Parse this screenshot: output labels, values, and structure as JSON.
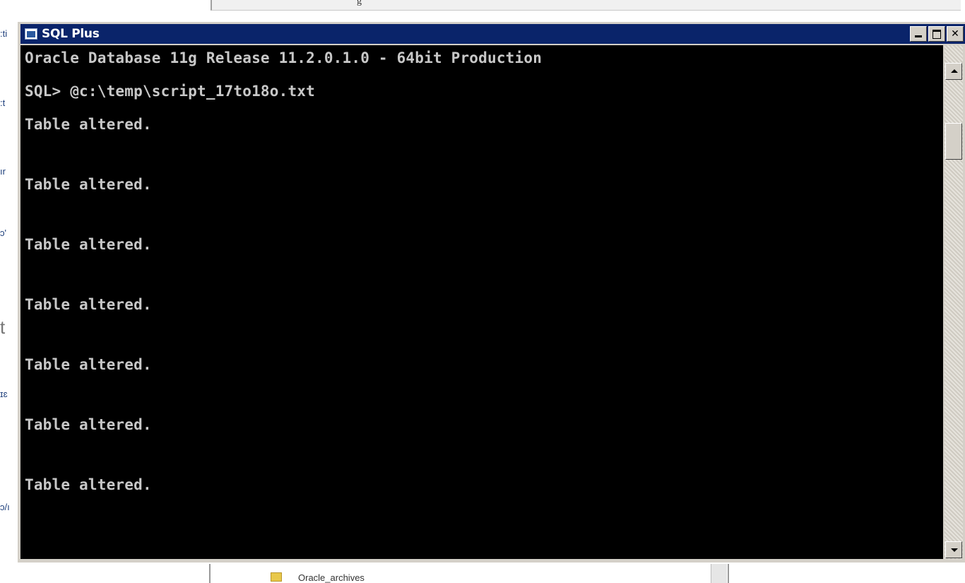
{
  "background": {
    "toolbar_text": "g",
    "left_fragments": [
      ":ti",
      ":t",
      "ır",
      "ɔ'",
      "t",
      "ɪɛ",
      "ɔ/ı"
    ],
    "bottom_folder_label": "Oracle_archives"
  },
  "window": {
    "title": "SQL Plus",
    "icon": "sqlplus-app-icon",
    "buttons": {
      "minimize": "minimize-icon",
      "maximize": "maximize-icon",
      "close_label": "✕"
    }
  },
  "console": {
    "lines": [
      "Oracle Database 11g Release 11.2.0.1.0 - 64bit Production",
      "SQL> @c:\\temp\\script_17to18o.txt",
      "Table altered.",
      "Table altered.",
      "Table altered.",
      "Table altered.",
      "Table altered.",
      "Table altered.",
      "Table altered."
    ]
  },
  "colors": {
    "titlebar": "#0a246a",
    "console_bg": "#000000",
    "console_text": "#c8c8c8",
    "chrome": "#d4d0c8"
  }
}
